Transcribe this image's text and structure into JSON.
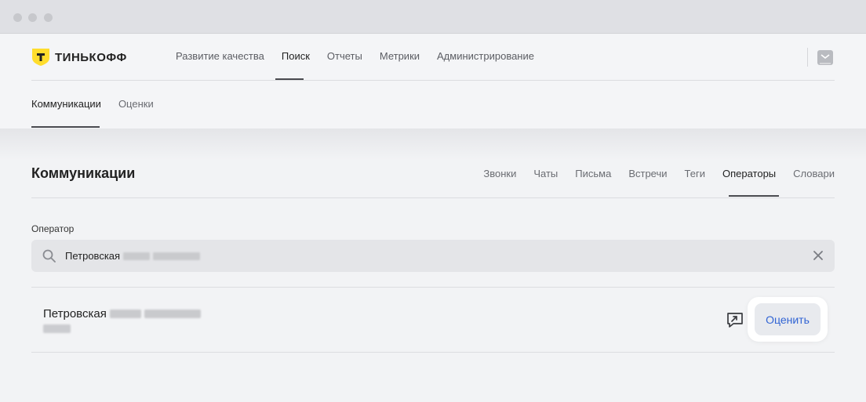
{
  "window": {
    "controls": [
      "close",
      "minimize",
      "maximize"
    ]
  },
  "brand": {
    "name": "ТИНЬКОФФ",
    "logo_letter": "Т",
    "logo_color": "#ffdd2d"
  },
  "topnav": {
    "items": [
      {
        "label": "Развитие качества"
      },
      {
        "label": "Поиск"
      },
      {
        "label": "Отчеты"
      },
      {
        "label": "Метрики"
      },
      {
        "label": "Администрирование"
      }
    ],
    "active": "Поиск"
  },
  "subnav": {
    "items": [
      {
        "label": "Коммуникации"
      },
      {
        "label": "Оценки"
      }
    ],
    "active": "Коммуникации"
  },
  "page": {
    "title": "Коммуникации",
    "tabs": [
      {
        "label": "Звонки"
      },
      {
        "label": "Чаты"
      },
      {
        "label": "Письма"
      },
      {
        "label": "Встречи"
      },
      {
        "label": "Теги"
      },
      {
        "label": "Операторы"
      },
      {
        "label": "Словари"
      }
    ],
    "active_tab": "Операторы"
  },
  "filter": {
    "label": "Оператор",
    "value": "Петровская",
    "value_redacted": true
  },
  "results": [
    {
      "name": "Петровская",
      "name_redacted": true,
      "subtitle_redacted": true,
      "action_label": "Оценить"
    }
  ],
  "colors": {
    "accent": "#3164d4",
    "brand": "#ffdd2d"
  }
}
